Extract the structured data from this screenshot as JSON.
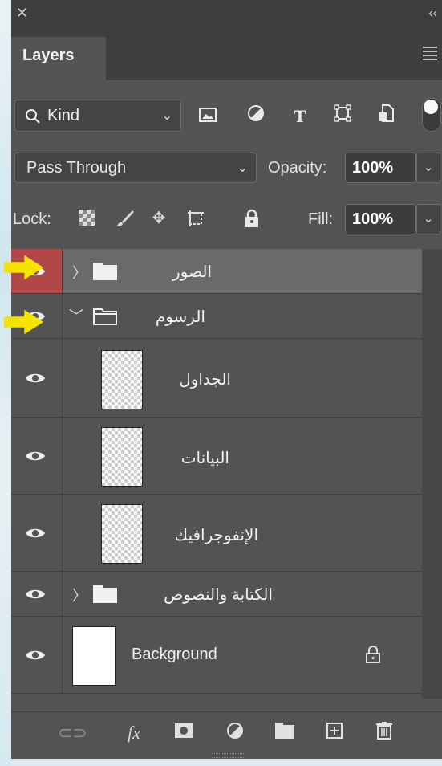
{
  "panel": {
    "title_tab": "Layers",
    "close_icon": "close-icon",
    "collapse_icon": "collapse-icon",
    "menu_icon": "panel-menu-icon"
  },
  "filter": {
    "kind_label": "Kind",
    "filter_icons": [
      "image-filter-icon",
      "adjustment-filter-icon",
      "type-filter-icon",
      "shape-filter-icon",
      "smart-object-filter-icon"
    ]
  },
  "blend": {
    "mode": "Pass Through",
    "opacity_label": "Opacity:",
    "opacity_value": "100%"
  },
  "lock": {
    "label": "Lock:",
    "fill_label": "Fill:",
    "fill_value": "100%"
  },
  "layers": [
    {
      "name": "الصور",
      "type": "group",
      "expanded": false,
      "selected": true,
      "visible": true
    },
    {
      "name": "الرسوم",
      "type": "group",
      "expanded": true,
      "visible": true
    },
    {
      "name": "الجداول",
      "type": "layer",
      "indent": true,
      "visible": true
    },
    {
      "name": "البيانات",
      "type": "layer",
      "indent": true,
      "visible": true
    },
    {
      "name": "الإنفوجرافيك",
      "type": "layer",
      "indent": true,
      "visible": true
    },
    {
      "name": "الكتابة والنصوص",
      "type": "group",
      "expanded": false,
      "visible": true
    },
    {
      "name": "Background",
      "type": "background",
      "locked": true,
      "visible": true
    }
  ],
  "colors": {
    "panel_bg": "#535353",
    "selected_row": "#6a6a6a",
    "eye_selected_bg": "#b24747",
    "arrow": "#f5e400"
  },
  "bottom_icons": [
    "link-layers-icon",
    "fx-icon",
    "layer-mask-icon",
    "adjustment-layer-icon",
    "new-group-icon",
    "new-layer-icon",
    "delete-icon"
  ]
}
